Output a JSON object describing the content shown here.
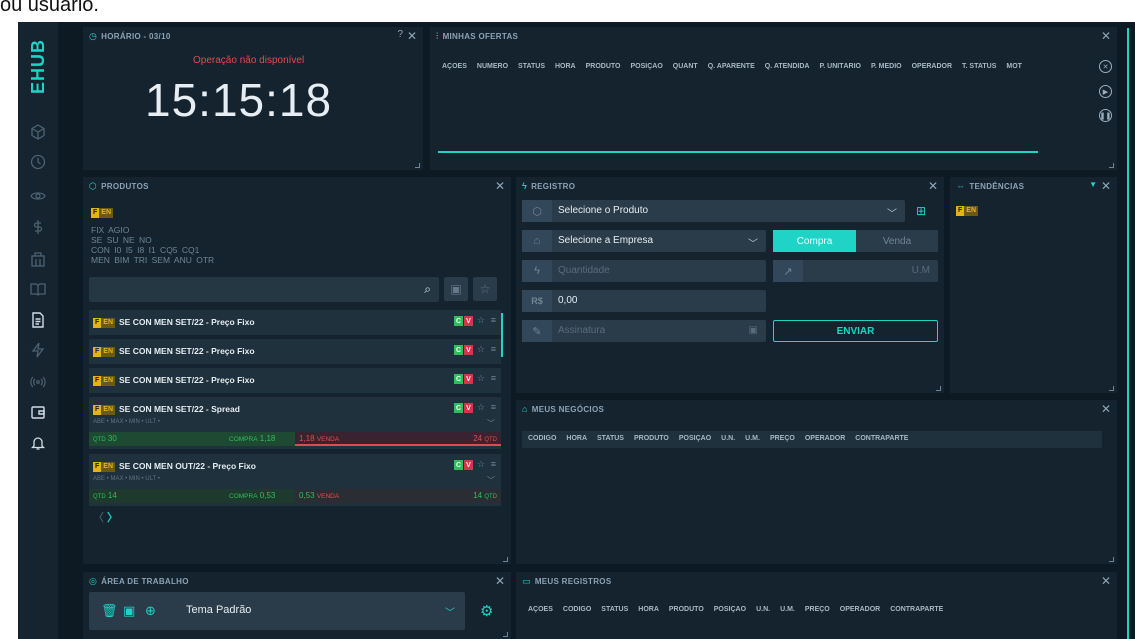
{
  "top_text": "ou usuário.",
  "sidebar": {
    "logo": "EHUB",
    "icons": [
      "cube-icon",
      "clock-icon",
      "eye-icon",
      "dollar-icon",
      "building-icon",
      "book-icon",
      "document-icon",
      "bolt-icon",
      "broadcast-icon",
      "wallet-icon",
      "bell-icon"
    ]
  },
  "horario": {
    "title": "HORÁRIO - 03/10",
    "status": "Operação não disponível",
    "time": "15:15:18",
    "close": "✕",
    "help": "?"
  },
  "ofertas": {
    "title": "MINHAS OFERTAS",
    "close": "✕",
    "columns": [
      "AÇÕES",
      "NÚMERO",
      "STATUS",
      "HORA",
      "PRODUTO",
      "POSIÇÃO",
      "QUANT",
      "Q. APARENTE",
      "Q. ATENDIDA",
      "P. UNITÁRIO",
      "P. MÉDIO",
      "OPERADOR",
      "T. STATUS",
      "MOT"
    ]
  },
  "produtos": {
    "title": "PRODUTOS",
    "close": "✕",
    "tag_f": "F",
    "tag_e": "EN",
    "filters": [
      "FIX AGIO",
      "SE SU NE NO",
      "CON I0 I5 I8 I1 CQ5 CQ1",
      "MEN BIM TRI SEM ANU OTR"
    ],
    "search_icon": "⌕",
    "rows": [
      {
        "name": "SE CON MEN SET/22 - Preço Fixo"
      },
      {
        "name": "SE CON MEN SET/22 - Preço Fixo"
      },
      {
        "name": "SE CON MEN SET/22 - Preço Fixo"
      },
      {
        "name": "SE CON MEN SET/22 - Spread",
        "sub": "ABE • MAX • MIN • ULT •",
        "qtd_label": "QTD",
        "qtd_left": "30",
        "compra_label": "COMPRA",
        "compra": "1,18",
        "venda": "1,18",
        "venda_label": "VENDA",
        "qtd_right": "24",
        "qtd_right_label": "QTD"
      },
      {
        "name": "SE CON MEN OUT/22 - Preço Fixo",
        "sub": "ABE • MAX • MIN • ULT •",
        "qtd_label": "QTD",
        "qtd_left": "14",
        "compra_label": "COMPRA",
        "compra": "0,53",
        "venda": "0,53",
        "venda_label": "VENDA",
        "qtd_right": "14",
        "qtd_right_label": "QTD"
      }
    ],
    "c": "C",
    "v": "V",
    "pager_prev": "〈",
    "pager_next": "〉"
  },
  "registro": {
    "title": "REGISTRO",
    "close": "✕",
    "produto": "Selecione o Produto",
    "empresa": "Selecione a Empresa",
    "compra": "Compra",
    "venda": "Venda",
    "quantidade": "Quantidade",
    "um": "U.M",
    "moeda": "R$",
    "valor": "0,00",
    "assinatura": "Assinatura",
    "enviar": "ENVIAR"
  },
  "tendencias": {
    "title": "TENDÊNCIAS",
    "close": "✕",
    "filter": "▼"
  },
  "negocios": {
    "title": "MEUS NEGÓCIOS",
    "close": "✕",
    "columns": [
      "CÓDIGO",
      "HORA",
      "STATUS",
      "PRODUTO",
      "POSIÇÃO",
      "U.N.",
      "U.M.",
      "PREÇO",
      "OPERADOR",
      "CONTRAPARTE"
    ]
  },
  "area": {
    "title": "ÁREA DE TRABALHO",
    "close": "✕",
    "tema": "Tema Padrão"
  },
  "registros": {
    "title": "MEUS REGISTROS",
    "close": "✕",
    "columns": [
      "AÇÕES",
      "CÓDIGO",
      "STATUS",
      "HORA",
      "PRODUTO",
      "POSIÇÃO",
      "U.N.",
      "U.M.",
      "PREÇO",
      "OPERADOR",
      "CONTRAPARTE"
    ]
  },
  "colors": {
    "accent": "#1fd3c6",
    "bg": "#0d1a24",
    "panel": "#15232e",
    "alert": "#e24b4b",
    "buy": "#2fbf5a"
  }
}
